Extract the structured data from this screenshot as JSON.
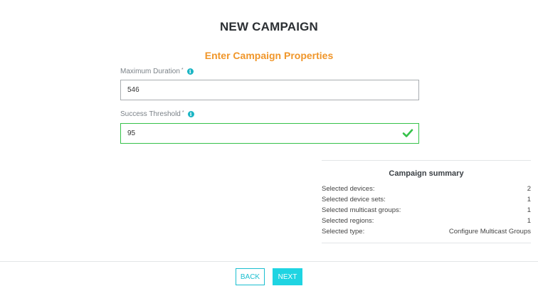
{
  "header": {
    "title": "NEW CAMPAIGN"
  },
  "form": {
    "section_title": "Enter Campaign Properties",
    "fields": [
      {
        "label": "Maximum Duration",
        "required_mark": "*",
        "value": "546",
        "state": "default"
      },
      {
        "label": "Success Threshold",
        "required_mark": "*",
        "value": "95",
        "state": "valid"
      }
    ]
  },
  "summary": {
    "title": "Campaign summary",
    "rows": [
      {
        "label": "Selected devices:",
        "value": "2"
      },
      {
        "label": "Selected device sets:",
        "value": "1"
      },
      {
        "label": "Selected multicast groups:",
        "value": "1"
      },
      {
        "label": "Selected regions:",
        "value": "1"
      },
      {
        "label": "Selected type:",
        "value": "Configure Multicast Groups"
      }
    ]
  },
  "footer": {
    "back_label": "BACK",
    "next_label": "NEXT"
  },
  "icons": {
    "info": "info-icon",
    "valid": "check-icon"
  },
  "colors": {
    "accent": "#1fd4e2",
    "section_title": "#f0962a",
    "valid": "#36c24a",
    "info": "#1bb5c4"
  }
}
